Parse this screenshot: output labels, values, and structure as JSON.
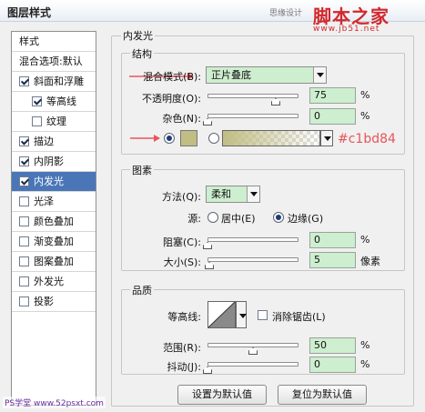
{
  "window": {
    "title": "图层样式",
    "watermark_text": "思缘设计",
    "watermark_logo": "脚本之家",
    "watermark_url": "www.jb51.net"
  },
  "left_panel": {
    "items": [
      {
        "label": "样式",
        "type": "header",
        "checked": null,
        "selected": false
      },
      {
        "label": "混合选项:默认",
        "type": "header",
        "checked": null,
        "selected": false
      },
      {
        "label": "斜面和浮雕",
        "type": "check",
        "checked": true,
        "selected": false
      },
      {
        "label": "等高线",
        "type": "subcheck",
        "checked": true,
        "selected": false
      },
      {
        "label": "纹理",
        "type": "subcheck",
        "checked": false,
        "selected": false
      },
      {
        "label": "描边",
        "type": "check",
        "checked": true,
        "selected": false
      },
      {
        "label": "内阴影",
        "type": "check",
        "checked": true,
        "selected": false
      },
      {
        "label": "内发光",
        "type": "check",
        "checked": true,
        "selected": true
      },
      {
        "label": "光泽",
        "type": "check",
        "checked": false,
        "selected": false
      },
      {
        "label": "颜色叠加",
        "type": "check",
        "checked": false,
        "selected": false
      },
      {
        "label": "渐变叠加",
        "type": "check",
        "checked": false,
        "selected": false
      },
      {
        "label": "图案叠加",
        "type": "check",
        "checked": false,
        "selected": false
      },
      {
        "label": "外发光",
        "type": "check",
        "checked": false,
        "selected": false
      },
      {
        "label": "投影",
        "type": "check",
        "checked": false,
        "selected": false
      }
    ]
  },
  "inner_glow": {
    "section_title": "内发光",
    "structure": {
      "title": "结构",
      "blend_mode_label": "混合模式(B):",
      "blend_mode_value": "正片叠底",
      "opacity_label": "不透明度(O):",
      "opacity_value": "75",
      "opacity_fraction": 0.75,
      "opacity_unit": "%",
      "noise_label": "杂色(N):",
      "noise_value": "0",
      "noise_fraction": 0,
      "noise_unit": "%",
      "glow_color": "#c1bd84",
      "color_annotation": "#c1bd84"
    },
    "elements": {
      "title": "图素",
      "technique_label": "方法(Q):",
      "technique_value": "柔和",
      "source_label": "源:",
      "source_center": "居中(E)",
      "source_edge": "边缘(G)",
      "source_selected": "edge",
      "choke_label": "阻塞(C):",
      "choke_value": "0",
      "choke_fraction": 0,
      "choke_unit": "%",
      "size_label": "大小(S):",
      "size_value": "5",
      "size_fraction": 0.02,
      "size_unit": "像素"
    },
    "quality": {
      "title": "品质",
      "contour_label": "等高线:",
      "anti_alias_label": "消除锯齿(L)",
      "anti_alias_checked": false,
      "range_label": "范围(R):",
      "range_value": "50",
      "range_fraction": 0.5,
      "range_unit": "%",
      "jitter_label": "抖动(J):",
      "jitter_value": "0",
      "jitter_fraction": 0,
      "jitter_unit": "%"
    },
    "buttons": {
      "make_default": "设置为默认值",
      "reset_default": "复位为默认值"
    }
  },
  "footer_watermark": "PS学堂 www.52psxt.com",
  "colors": {
    "annotation_red": "#e8555a",
    "selected_blue": "#4a76b8",
    "field_green": "#cdeecf"
  }
}
